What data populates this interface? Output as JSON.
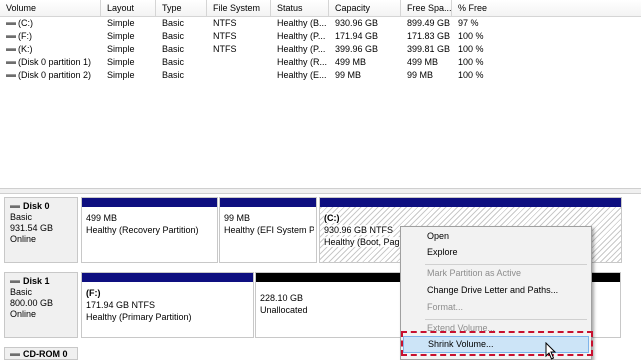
{
  "list": {
    "columns": [
      "Volume",
      "Layout",
      "Type",
      "File System",
      "Status",
      "Capacity",
      "Free Spa...",
      "% Free"
    ],
    "rows": [
      [
        "(C:)",
        "Simple",
        "Basic",
        "NTFS",
        "Healthy (B...",
        "930.96 GB",
        "899.49 GB",
        "97 %"
      ],
      [
        "(F:)",
        "Simple",
        "Basic",
        "NTFS",
        "Healthy (P...",
        "171.94 GB",
        "171.83 GB",
        "100 %"
      ],
      [
        "(K:)",
        "Simple",
        "Basic",
        "NTFS",
        "Healthy (P...",
        "399.96 GB",
        "399.81 GB",
        "100 %"
      ],
      [
        "(Disk 0 partition 1)",
        "Simple",
        "Basic",
        "",
        "Healthy (R...",
        "499 MB",
        "499 MB",
        "100 %"
      ],
      [
        "(Disk 0 partition 2)",
        "Simple",
        "Basic",
        "",
        "Healthy (E...",
        "99 MB",
        "99 MB",
        "100 %"
      ]
    ]
  },
  "disks": {
    "disk0": {
      "name": "Disk 0",
      "type": "Basic",
      "size": "931.54 GB",
      "status": "Online",
      "partitions": {
        "p1": {
          "line1": "499 MB",
          "line2": "Healthy (Recovery Partition)"
        },
        "p2": {
          "line1": "99 MB",
          "line2": "Healthy (EFI System Pa"
        },
        "p3": {
          "title": "(C:)",
          "line1": "930.96 GB NTFS",
          "line2": "Healthy (Boot, Pag"
        }
      }
    },
    "disk1": {
      "name": "Disk 1",
      "type": "Basic",
      "size": "800.00 GB",
      "status": "Online",
      "partitions": {
        "p1": {
          "title": "(F:)",
          "line1": "171.94 GB NTFS",
          "line2": "Healthy (Primary Partition)"
        },
        "p2": {
          "line1": "228.10 GB",
          "line2": "Unallocated"
        }
      }
    },
    "cdrom": {
      "name": "CD-ROM 0"
    }
  },
  "context_menu": {
    "open": "Open",
    "explore": "Explore",
    "mark_active": "Mark Partition as Active",
    "change_letter": "Change Drive Letter and Paths...",
    "format": "Format...",
    "extend": "Extend Volume...",
    "shrink": "Shrink Volume..."
  },
  "colors": {
    "primary_partition_bar": "#0e0f80",
    "unallocated_bar": "#000000",
    "highlight_outline": "#c8102e",
    "menu_highlight": "#cce4f7"
  }
}
